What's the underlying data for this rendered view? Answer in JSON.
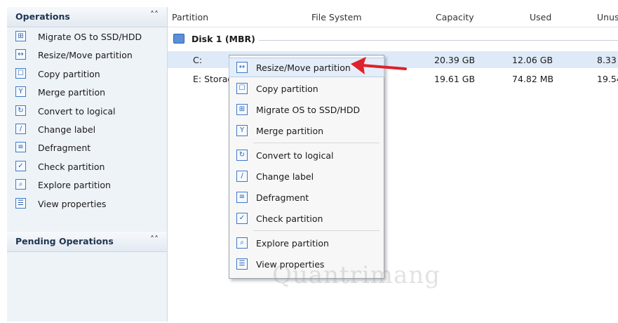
{
  "operations": {
    "title": "Operations",
    "items": [
      {
        "label": "Migrate OS to SSD/HDD",
        "icon": "migrate-icon"
      },
      {
        "label": "Resize/Move partition",
        "icon": "resize-icon"
      },
      {
        "label": "Copy partition",
        "icon": "copy-icon"
      },
      {
        "label": "Merge partition",
        "icon": "merge-icon"
      },
      {
        "label": "Convert to logical",
        "icon": "convert-icon"
      },
      {
        "label": "Change label",
        "icon": "label-icon"
      },
      {
        "label": "Defragment",
        "icon": "defragment-icon"
      },
      {
        "label": "Check partition",
        "icon": "check-icon"
      },
      {
        "label": "Explore partition",
        "icon": "explore-icon"
      },
      {
        "label": "View properties",
        "icon": "properties-icon"
      }
    ]
  },
  "pending": {
    "title": "Pending Operations"
  },
  "table": {
    "columns": [
      "Partition",
      "File System",
      "Capacity",
      "Used",
      "Unus"
    ],
    "disk": "Disk 1 (MBR)",
    "rows": [
      {
        "partition": "C:",
        "capacity": "20.39 GB",
        "used": "12.06 GB",
        "unused": "8.33"
      },
      {
        "partition": "E: Storag",
        "capacity": "19.61 GB",
        "used": "74.82 MB",
        "unused": "19.54"
      }
    ]
  },
  "context_menu": {
    "items": [
      {
        "label": "Resize/Move partition",
        "icon": "resize-icon"
      },
      {
        "label": "Copy partition",
        "icon": "copy-icon"
      },
      {
        "label": "Migrate OS to SSD/HDD",
        "icon": "migrate-icon"
      },
      {
        "label": "Merge partition",
        "icon": "merge-icon"
      },
      {
        "label": "Convert to logical",
        "icon": "convert-icon"
      },
      {
        "label": "Change label",
        "icon": "label-icon"
      },
      {
        "label": "Defragment",
        "icon": "defragment-icon"
      },
      {
        "label": "Check partition",
        "icon": "check-icon"
      },
      {
        "label": "Explore partition",
        "icon": "explore-icon"
      },
      {
        "label": "View properties",
        "icon": "properties-icon"
      }
    ]
  },
  "watermark": "Quantrimang",
  "colors": {
    "accent": "#3d78c8",
    "arrow": "#e0202a",
    "selection": "#dfeaf8"
  }
}
